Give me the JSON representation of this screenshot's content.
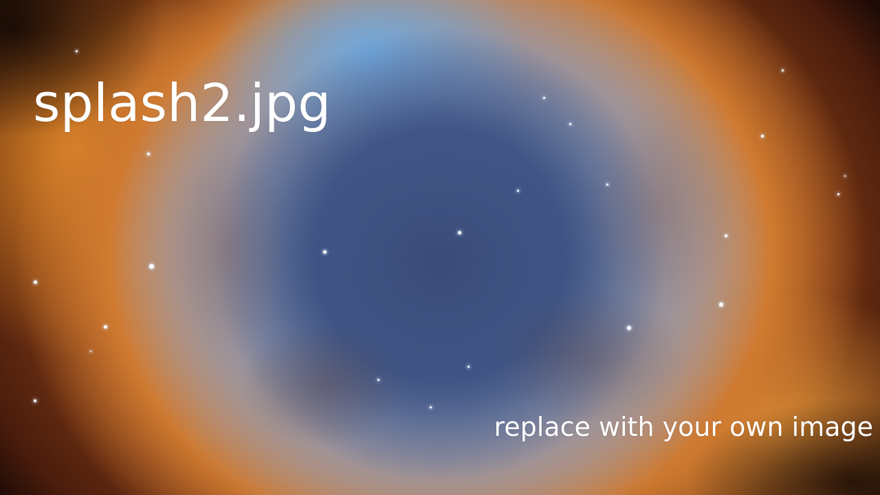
{
  "splash": {
    "title": "splash2.jpg",
    "subtitle": "replace with your own image"
  },
  "colors": {
    "text": "#ffffff",
    "nebula_core": "#42598a",
    "nebula_ring": "#d07a30",
    "background_edge": "#1e0b06"
  }
}
